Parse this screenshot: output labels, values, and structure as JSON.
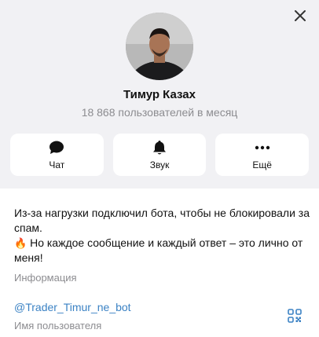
{
  "profile": {
    "name": "Тимур Казах",
    "subscribers": "18 868 пользователей в месяц"
  },
  "actions": [
    {
      "label": "Чат",
      "icon": "chat-icon"
    },
    {
      "label": "Звук",
      "icon": "bell-icon"
    },
    {
      "label": "Ещё",
      "icon": "more-icon"
    }
  ],
  "info": {
    "bio_line1": "Из-за нагрузки подключил бота, чтобы не блокировали за спам.",
    "bio_emoji": "🔥",
    "bio_line2": "Но каждое сообщение и каждый ответ – это лично от меня!",
    "bio_caption": "Информация",
    "username": "@Trader_Timur_ne_bot",
    "username_caption": "Имя пользователя"
  },
  "colors": {
    "accent": "#3b82c4",
    "secondary_text": "#8c8c90",
    "background": "#f1f1f4"
  }
}
